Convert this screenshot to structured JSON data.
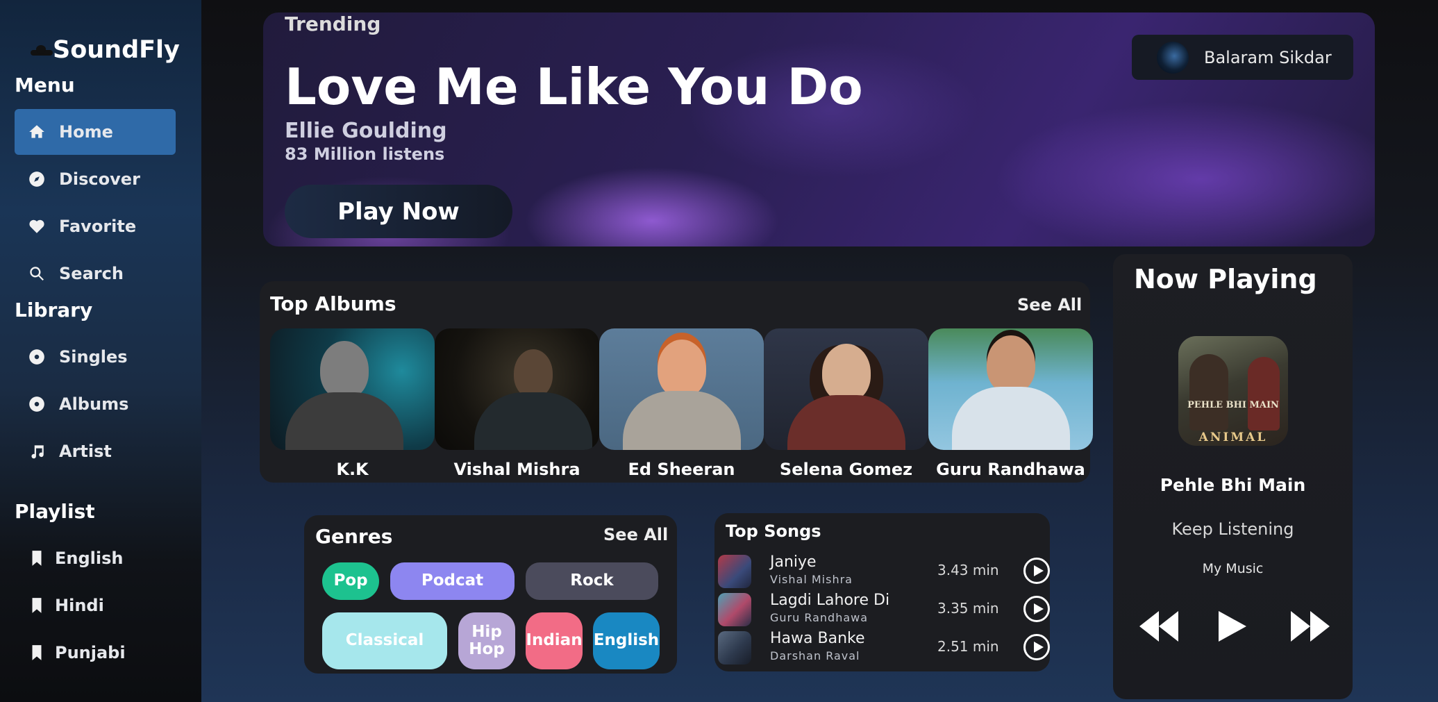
{
  "app": {
    "name": "SoundFly"
  },
  "sidebar": {
    "menu_title": "Menu",
    "menu_items": [
      {
        "label": "Home",
        "icon": "home-icon",
        "active": true
      },
      {
        "label": "Discover",
        "icon": "compass-icon",
        "active": false
      },
      {
        "label": "Favorite",
        "icon": "heart-icon",
        "active": false
      },
      {
        "label": "Search",
        "icon": "search-icon",
        "active": false
      }
    ],
    "library_title": "Library",
    "library_items": [
      {
        "label": "Singles",
        "icon": "disc-icon"
      },
      {
        "label": "Albums",
        "icon": "disc-icon"
      },
      {
        "label": "Artist",
        "icon": "music-note-icon"
      }
    ],
    "playlist_title": "Playlist",
    "playlist_items": [
      {
        "label": "English",
        "icon": "bookmark-icon"
      },
      {
        "label": "Hindi",
        "icon": "bookmark-icon"
      },
      {
        "label": "Punjabi",
        "icon": "bookmark-icon"
      }
    ]
  },
  "hero": {
    "section_label": "Trending",
    "song_title": "Love Me Like You Do",
    "artist": "Ellie Goulding",
    "listens": "83 Million listens",
    "play_button": "Play Now"
  },
  "user": {
    "name": "Balaram Sikdar"
  },
  "top_albums": {
    "title": "Top Albums",
    "see_all": "See All",
    "items": [
      {
        "name": "K.K"
      },
      {
        "name": "Vishal Mishra"
      },
      {
        "name": "Ed Sheeran"
      },
      {
        "name": "Selena Gomez"
      },
      {
        "name": "Guru Randhawa"
      }
    ]
  },
  "genres": {
    "title": "Genres",
    "see_all": "See All",
    "items": [
      {
        "label": "Pop",
        "color": "#1dc28f"
      },
      {
        "label": "Podcat",
        "color": "#8d86f0"
      },
      {
        "label": "Rock",
        "color": "#4b4b5c"
      },
      {
        "label": "Classical",
        "color": "#a6e7ec"
      },
      {
        "label": "Hip Hop",
        "color": "#b7a6d6"
      },
      {
        "label": "Indian",
        "color": "#f26c86"
      },
      {
        "label": "English",
        "color": "#1988c2"
      }
    ]
  },
  "top_songs": {
    "title": "Top Songs",
    "items": [
      {
        "title": "Janiye",
        "artist": "Vishal Mishra",
        "duration": "3.43 min"
      },
      {
        "title": "Lagdi Lahore Di",
        "artist": "Guru Randhawa",
        "duration": "3.35 min"
      },
      {
        "title": "Hawa Banke",
        "artist": "Darshan Raval",
        "duration": "2.51 min"
      }
    ]
  },
  "now_playing": {
    "title": "Now Playing",
    "song": "Pehle Bhi Main",
    "keep_listening": "Keep Listening",
    "my_music": "My Music",
    "cover_text": "PEHLE BHI MAIN",
    "cover_brand": "ANIMAL"
  }
}
